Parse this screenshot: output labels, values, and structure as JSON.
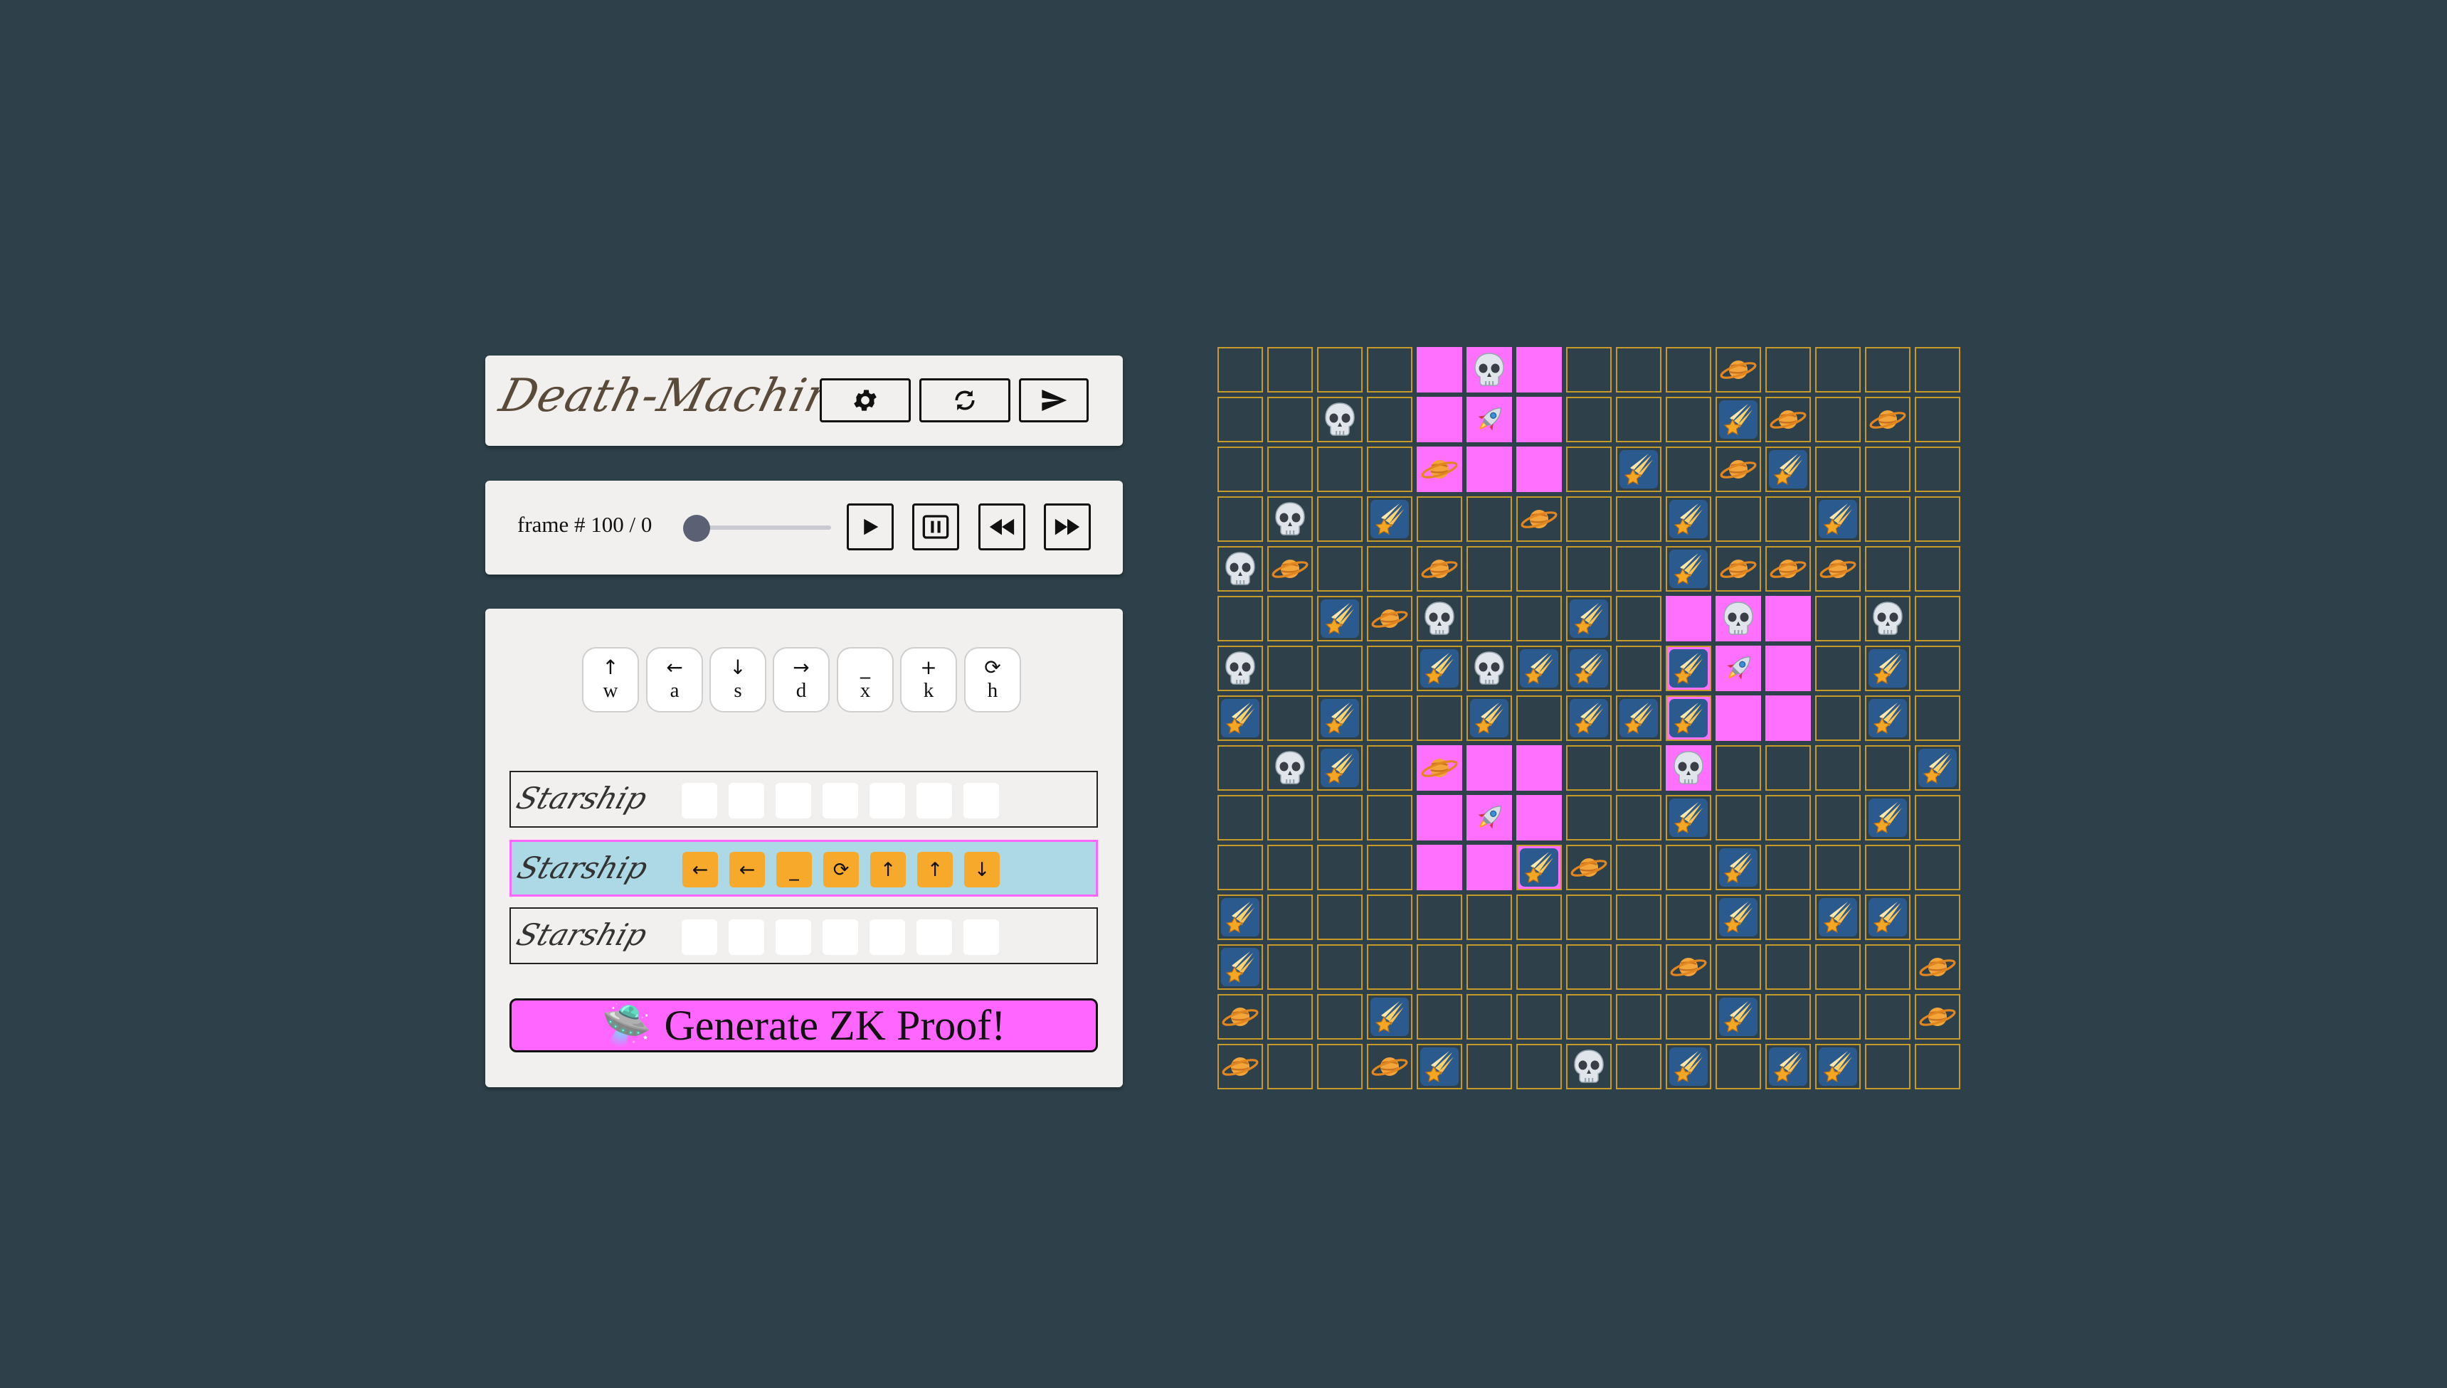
{
  "title": {
    "text": "Death-Machine"
  },
  "frame": {
    "label": "frame # 100 / 0",
    "progress": 0
  },
  "keys": [
    {
      "arrow": "↑",
      "key": "w"
    },
    {
      "arrow": "←",
      "key": "a"
    },
    {
      "arrow": "↓",
      "key": "s"
    },
    {
      "arrow": "→",
      "key": "d"
    },
    {
      "arrow": "_",
      "key": "x"
    },
    {
      "arrow": "+",
      "key": "k"
    },
    {
      "arrow": "⟳",
      "key": "h"
    }
  ],
  "ships": [
    {
      "name": "Starship",
      "moves": [
        "",
        "",
        "",
        "",
        "",
        "",
        ""
      ],
      "selected": false
    },
    {
      "name": "Starship",
      "moves": [
        "←",
        "←",
        "_",
        "⟳",
        "↑",
        "↑",
        "↓"
      ],
      "selected": true
    },
    {
      "name": "Starship",
      "moves": [
        "",
        "",
        "",
        "",
        "",
        "",
        ""
      ],
      "selected": false
    }
  ],
  "proof_button": {
    "icon": "ufo-icon",
    "label": "Generate ZK Proof!"
  },
  "colors": {
    "background": "#2e414a",
    "highlight": "#ff66ff",
    "grid": "#c79a2a",
    "move": "#f6a92a"
  },
  "board": {
    "size": 15,
    "legend": {
      "K": "skull-icon",
      "P": "planet-icon",
      "C": "comet-icon",
      "R": "rocket-icon"
    },
    "rows": [
      "....HKH...P....",
      "..K.HRH...CP.P.",
      "....PHH.C.PC...",
      ".K.C..P..C..C..",
      "KP..P....CPPP..",
      "..CPK..C.HKH.K.",
      "K...CKCC.bRH.C.",
      "C.C..C.CCbHH.C.",
      ".KC.PHH..K....C",
      "....HRH..C...C.",
      "....HHbP..C....",
      "C.........C.CC",
      "C........P....P",
      "P..C......C...P",
      "P..PC..K.C.CC.."
    ]
  }
}
